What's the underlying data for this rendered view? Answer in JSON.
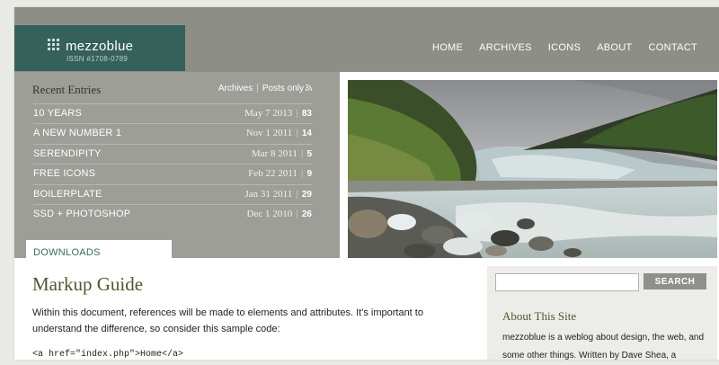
{
  "brand": {
    "name": "mezzoblue",
    "issn": "ISSN #1708-0789"
  },
  "nav": [
    "HOME",
    "ARCHIVES",
    "ICONS",
    "ABOUT",
    "CONTACT"
  ],
  "recent": {
    "title": "Recent Entries",
    "archives_link": "Archives",
    "posts_only_link": "Posts only",
    "entries": [
      {
        "title": "10 YEARS",
        "date": "May 7 2013",
        "count": "83"
      },
      {
        "title": "A NEW NUMBER 1",
        "date": "Nov 1 2011",
        "count": "14"
      },
      {
        "title": "SERENDIPITY",
        "date": "Mar 8 2011",
        "count": "5"
      },
      {
        "title": "FREE ICONS",
        "date": "Feb 22 2011",
        "count": "9"
      },
      {
        "title": "BOILERPLATE",
        "date": "Jan 31 2011",
        "count": "29"
      },
      {
        "title": "SSD + PHOTOSHOP",
        "date": "Dec 1 2010",
        "count": "26"
      }
    ]
  },
  "downloads_tab": "DOWNLOADS",
  "article": {
    "title": "Markup Guide",
    "body": "Within this document, references will be made to elements and attributes. It's important to understand the difference, so consider this sample code:",
    "code": "<a href=\"index.php\">Home</a>"
  },
  "sidebar": {
    "search_button": "SEARCH",
    "search_placeholder": "",
    "about_title": "About This Site",
    "about_text": "mezzoblue is a weblog about design, the web, and some other things. Written by Dave Shea, a"
  },
  "colors": {
    "header": "#8d8e86",
    "logo_bg": "#36615b",
    "recent_bg": "#9d9e97",
    "heading": "#4e5830"
  }
}
